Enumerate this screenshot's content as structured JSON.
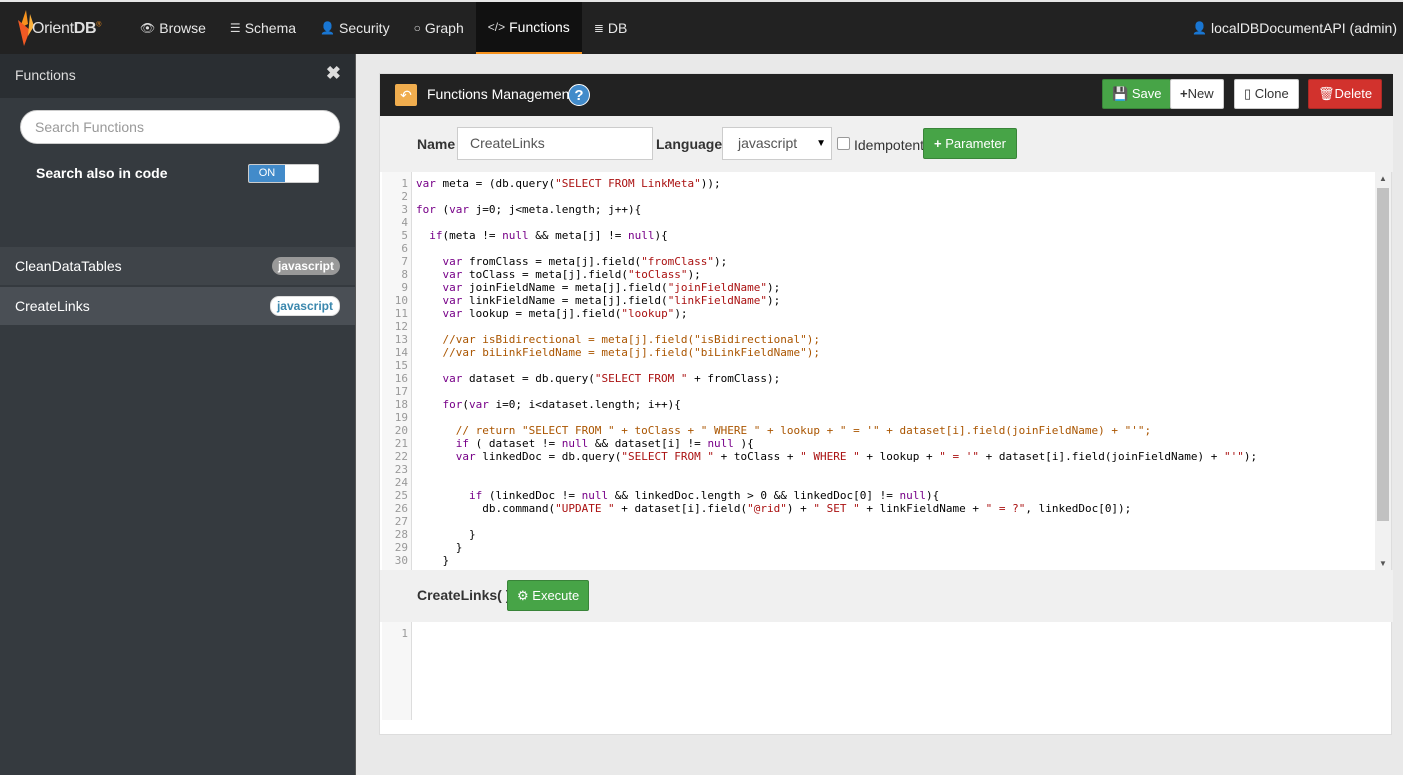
{
  "brand": {
    "name_a": "Orient",
    "name_b": "DB",
    "mark": "®"
  },
  "nav": [
    {
      "icon": "👁",
      "label": "Browse"
    },
    {
      "icon": "☰",
      "label": "Schema"
    },
    {
      "icon": "👤",
      "label": "Security"
    },
    {
      "icon": "○",
      "label": "Graph"
    },
    {
      "icon": "</>",
      "label": "Functions"
    },
    {
      "icon": "≣",
      "label": "DB"
    }
  ],
  "user": {
    "label": "localDBDocumentAPI (admin)"
  },
  "sidebar": {
    "title": "Functions",
    "search_placeholder": "Search Functions",
    "search_code_label": "Search also in code",
    "toggle_on": "ON",
    "functions": [
      {
        "name": "CleanDataTables",
        "language": "javascript"
      },
      {
        "name": "CreateLinks",
        "language": "javascript"
      }
    ]
  },
  "panel": {
    "title": "Functions Management",
    "help": "?",
    "buttons": {
      "save": "Save",
      "new": "New",
      "clone": "Clone",
      "delete": "Delete"
    },
    "name_label": "Name",
    "name_value": "CreateLinks",
    "language_label": "Language",
    "language_value": "javascript",
    "idempotent_label": "Idempotent",
    "parameter_button": "Parameter",
    "call_label": "CreateLinks( )",
    "execute_button": "Execute"
  },
  "code_lines": [
    "var meta = (db.query(\"SELECT FROM LinkMeta\"));",
    "",
    "for (var j=0; j<meta.length; j++){",
    "",
    "  if(meta != null && meta[j] != null){",
    "",
    "    var fromClass = meta[j].field(\"fromClass\");",
    "    var toClass = meta[j].field(\"toClass\");",
    "    var joinFieldName = meta[j].field(\"joinFieldName\");",
    "    var linkFieldName = meta[j].field(\"linkFieldName\");",
    "    var lookup = meta[j].field(\"lookup\");",
    "",
    "    //var isBidirectional = meta[j].field(\"isBidirectional\");",
    "    //var biLinkFieldName = meta[j].field(\"biLinkFieldName\");",
    "",
    "    var dataset = db.query(\"SELECT FROM \" + fromClass);",
    "",
    "    for(var i=0; i<dataset.length; i++){",
    "",
    "      // return \"SELECT FROM \" + toClass + \" WHERE \" + lookup + \" = '\" + dataset[i].field(joinFieldName) + \"'\";",
    "      if ( dataset != null && dataset[i] != null ){",
    "      var linkedDoc = db.query(\"SELECT FROM \" + toClass + \" WHERE \" + lookup + \" = '\" + dataset[i].field(joinFieldName) + \"'\");",
    "",
    "",
    "        if (linkedDoc != null && linkedDoc.length > 0 && linkedDoc[0] != null){",
    "          db.command(\"UPDATE \" + dataset[i].field(\"@rid\") + \" SET \" + linkFieldName + \" = ?\", linkedDoc[0]);",
    "",
    "        }",
    "      }",
    "    }"
  ],
  "output_lines": [
    ""
  ],
  "colors": {
    "accent": "#f7931e",
    "success": "#47a447",
    "danger": "#d2322d",
    "info": "#428bca"
  }
}
